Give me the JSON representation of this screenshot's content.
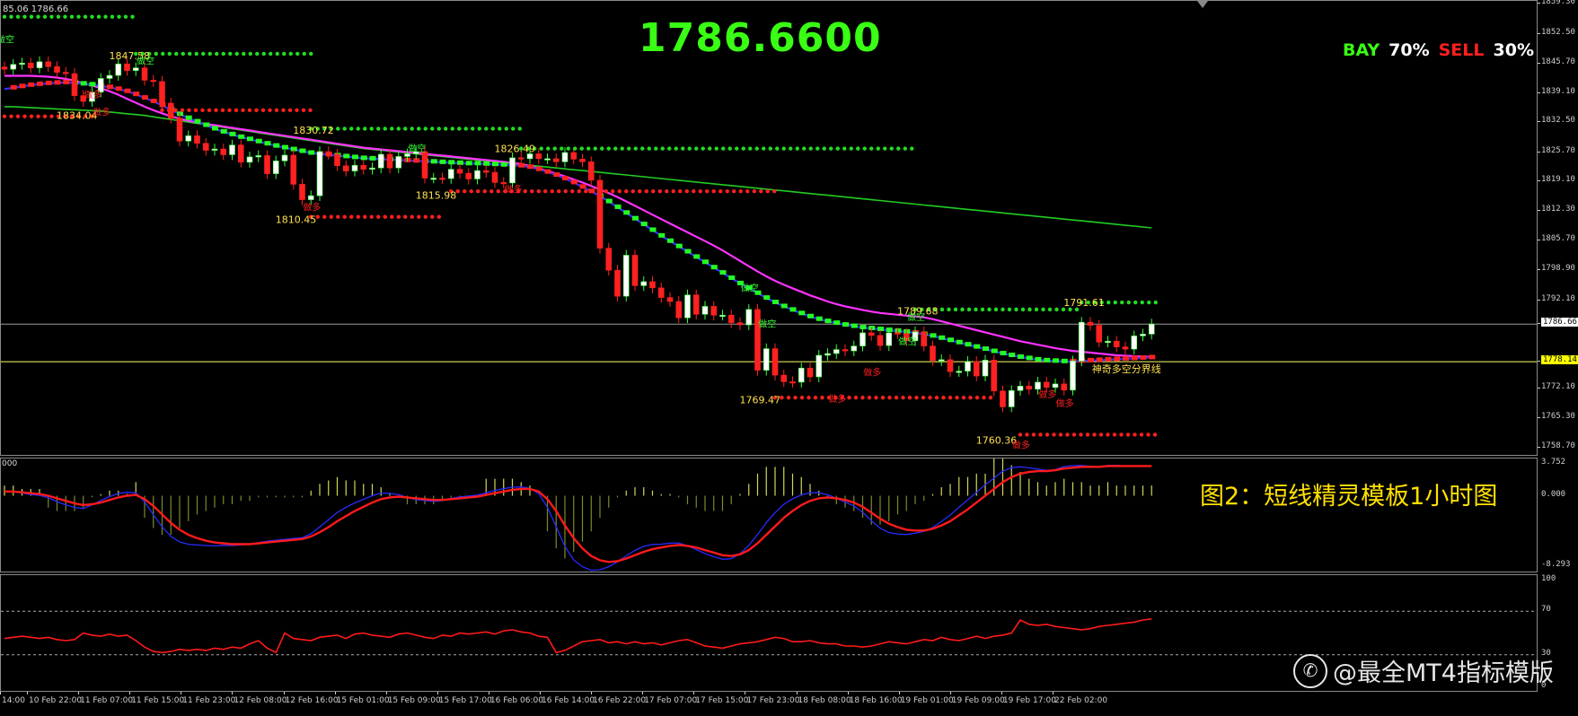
{
  "top_left_info": "85.06 1786.66",
  "big_price": "1786.6600",
  "signal": {
    "bay_label": "BAY",
    "bay_value": "70%",
    "sell_label": "SELL",
    "sell_value": "30%"
  },
  "caption": "图2：短线精灵模板1小时图",
  "watermark": "@最全MT4指标模版",
  "watermark_icon": "logo",
  "macd_top_left": "000",
  "colors": {
    "bull_candle": "#ffffff",
    "bear_candle": "#ff2020",
    "green_dots": "#22dd22",
    "red_dots": "#ff2020",
    "ma_magenta": "#ff33ff",
    "ma_blue": "#3030ff",
    "ma_green": "#22cc22",
    "price_line": "#ffff66",
    "label_yellow": "#ffe14d"
  },
  "price_axis": {
    "labels": [
      "1859.30",
      "1852.50",
      "1845.70",
      "1839.10",
      "1832.50",
      "1825.70",
      "1819.10",
      "1812.30",
      "1805.70",
      "1798.90",
      "1792.10",
      "1786.66",
      "1778.14",
      "1772.10",
      "1765.30",
      "1758.70"
    ],
    "values": [
      1859.3,
      1852.5,
      1845.7,
      1839.1,
      1832.5,
      1825.7,
      1819.1,
      1812.3,
      1805.7,
      1798.9,
      1792.1,
      1786.66,
      1778.14,
      1772.1,
      1765.3,
      1758.7
    ],
    "current_price": "1786.66",
    "yellow_line_price": "1778.14"
  },
  "macd_axis": {
    "labels": [
      "3.752",
      "0.000",
      "-8.293"
    ],
    "values": [
      3.752,
      0,
      -8.293
    ]
  },
  "rsi_axis": {
    "labels": [
      "100",
      "70",
      "30",
      "0"
    ],
    "values": [
      100,
      70,
      30,
      0
    ]
  },
  "time_axis": [
    "14:00",
    "10 Feb 22:00",
    "11 Feb 07:00",
    "11 Feb 15:00",
    "11 Feb 23:00",
    "12 Feb 08:00",
    "12 Feb 16:00",
    "15 Feb 01:00",
    "15 Feb 09:00",
    "15 Feb 17:00",
    "16 Feb 06:00",
    "16 Feb 14:00",
    "16 Feb 22:00",
    "17 Feb 07:00",
    "17 Feb 15:00",
    "17 Feb 23:00",
    "18 Feb 08:00",
    "18 Feb 16:00",
    "19 Feb 01:00",
    "19 Feb 09:00",
    "19 Feb 17:00",
    "22 Feb 02:00"
  ],
  "swing_labels": [
    {
      "text": "1847.58",
      "price": 1847.58,
      "bar": 14
    },
    {
      "text": "1834.04",
      "price": 1834.04,
      "bar": 8
    },
    {
      "text": "1830.72",
      "price": 1830.72,
      "bar": 35
    },
    {
      "text": "1810.45",
      "price": 1810.45,
      "bar": 33
    },
    {
      "text": "1815.98",
      "price": 1815.98,
      "bar": 49
    },
    {
      "text": "1826.49",
      "price": 1826.49,
      "bar": 58
    },
    {
      "text": "1789.68",
      "price": 1789.68,
      "bar": 104
    },
    {
      "text": "1769.47",
      "price": 1769.47,
      "bar": 86
    },
    {
      "text": "1760.36",
      "price": 1760.36,
      "bar": 113
    },
    {
      "text": "1791.61",
      "price": 1791.61,
      "bar": 123
    }
  ],
  "signal_tags": [
    {
      "text": "做空",
      "price": 1850.5,
      "bar": 0
    },
    {
      "text": "做空",
      "price": 1845.6,
      "bar": 16
    },
    {
      "text": "做多",
      "price": 1838.0,
      "bar": 10
    },
    {
      "text": "做多",
      "price": 1834.0,
      "bar": 11
    },
    {
      "text": "做空",
      "price": 1825.8,
      "bar": 47
    },
    {
      "text": "做多",
      "price": 1812.5,
      "bar": 35
    },
    {
      "text": "做多",
      "price": 1816.5,
      "bar": 58
    },
    {
      "text": "做空",
      "price": 1794.2,
      "bar": 85
    },
    {
      "text": "做空",
      "price": 1786.0,
      "bar": 87
    },
    {
      "text": "做多",
      "price": 1769.0,
      "bar": 95
    },
    {
      "text": "做空",
      "price": 1787.5,
      "bar": 104
    },
    {
      "text": "做空",
      "price": 1782.0,
      "bar": 103
    },
    {
      "text": "做多",
      "price": 1775.0,
      "bar": 99
    },
    {
      "text": "做多",
      "price": 1770.0,
      "bar": 119
    },
    {
      "text": "做多",
      "price": 1768.0,
      "bar": 121
    },
    {
      "text": "做多",
      "price": 1758.5,
      "bar": 116
    }
  ],
  "divider_label": "神奇多空分界线",
  "dot_lines": [
    {
      "color": "green",
      "price": 1856.4,
      "from": 0,
      "to": 15
    },
    {
      "color": "green",
      "price": 1848.0,
      "from": 15,
      "to": 35
    },
    {
      "color": "red",
      "price": 1833.8,
      "from": 0,
      "to": 10
    },
    {
      "color": "red",
      "price": 1835.2,
      "from": 18,
      "to": 35
    },
    {
      "color": "green",
      "price": 1831.0,
      "from": 35,
      "to": 59
    },
    {
      "color": "green",
      "price": 1826.5,
      "from": 59,
      "to": 104
    },
    {
      "color": "red",
      "price": 1811.0,
      "from": 35,
      "to": 50
    },
    {
      "color": "red",
      "price": 1816.8,
      "from": 51,
      "to": 88
    },
    {
      "color": "red",
      "price": 1770.0,
      "from": 88,
      "to": 113
    },
    {
      "color": "green",
      "price": 1790.0,
      "from": 104,
      "to": 123
    },
    {
      "color": "green",
      "price": 1791.6,
      "from": 123,
      "to": 132
    },
    {
      "color": "red",
      "price": 1761.6,
      "from": 116,
      "to": 132
    }
  ],
  "chart_data": {
    "type": "candlestick",
    "title": "",
    "bars": 132,
    "close": [
      1844.5,
      1845.6,
      1845.9,
      1844.8,
      1846.2,
      1845.1,
      1843.8,
      1843.5,
      1838.5,
      1837.2,
      1839.3,
      1842.4,
      1843.1,
      1845.7,
      1844.2,
      1844.8,
      1842.0,
      1841.7,
      1836.8,
      1833.4,
      1828.2,
      1829.4,
      1827.7,
      1826.1,
      1826.4,
      1825.1,
      1827.3,
      1823.4,
      1824.6,
      1824.9,
      1820.8,
      1823.7,
      1825.0,
      1818.4,
      1814.9,
      1815.8,
      1825.8,
      1825.2,
      1822.6,
      1821.4,
      1822.7,
      1821.8,
      1822.1,
      1825.2,
      1822.1,
      1824.7,
      1825.3,
      1825.8,
      1819.8,
      1819.8,
      1819.7,
      1821.8,
      1820.9,
      1819.6,
      1821.5,
      1821.1,
      1818.8,
      1818.7,
      1824.4,
      1824.2,
      1825.3,
      1824.2,
      1824.2,
      1823.5,
      1825.6,
      1824.1,
      1823.5,
      1819.3,
      1803.9,
      1798.9,
      1793.0,
      1802.3,
      1795.4,
      1796.3,
      1794.9,
      1792.7,
      1791.8,
      1788.1,
      1793.3,
      1788.9,
      1790.7,
      1788.7,
      1788.7,
      1787.0,
      1786.5,
      1790.0,
      1776.2,
      1781.1,
      1775.1,
      1773.6,
      1773.5,
      1776.7,
      1774.7,
      1779.6,
      1780.0,
      1780.9,
      1780.6,
      1781.7,
      1784.7,
      1784.1,
      1781.8,
      1784.7,
      1784.5,
      1782.9,
      1784.9,
      1781.7,
      1778.4,
      1778.6,
      1775.9,
      1776.0,
      1778.2,
      1774.9,
      1778.5,
      1771.5,
      1767.9,
      1771.6,
      1772.6,
      1771.9,
      1773.5,
      1772.3,
      1773.1,
      1771.7,
      1778.3,
      1787.1,
      1786.4,
      1782.6,
      1782.8,
      1781.5,
      1781.0,
      1784.0,
      1784.4,
      1786.7
    ],
    "ma_magenta": [
      1843,
      1843,
      1843,
      1843,
      1842.9,
      1842.8,
      1842.6,
      1842.3,
      1841.9,
      1841.3,
      1840.8,
      1840.2,
      1839.5,
      1838.7,
      1837.8,
      1836.9,
      1836,
      1835.2,
      1834.5,
      1833.8,
      1833.3,
      1832.8,
      1832.4,
      1832.1,
      1831.8,
      1831.5,
      1831.2,
      1830.9,
      1830.6,
      1830.3,
      1830,
      1829.7,
      1829.4,
      1829.1,
      1828.8,
      1828.5,
      1828.2,
      1827.9,
      1827.6,
      1827.3,
      1827,
      1826.7,
      1826.5,
      1826.3,
      1826.1,
      1825.9,
      1825.7,
      1825.5,
      1825.3,
      1825.1,
      1824.9,
      1824.7,
      1824.5,
      1824.3,
      1824.1,
      1823.9,
      1823.7,
      1823.5,
      1823.3,
      1823,
      1822.5,
      1822,
      1821.4,
      1820.8,
      1820.2,
      1819.5,
      1818.8,
      1818,
      1817.2,
      1816.4,
      1815.5,
      1814.5,
      1813.5,
      1812.5,
      1811.5,
      1810.5,
      1809.5,
      1808.5,
      1807.5,
      1806.5,
      1805.5,
      1804.5,
      1803.4,
      1802.2,
      1801,
      1799.8,
      1798.6,
      1797.5,
      1796.5,
      1795.6,
      1794.8,
      1794,
      1793.2,
      1792.5,
      1791.8,
      1791.2,
      1790.7,
      1790.3,
      1789.9,
      1789.5,
      1789.2,
      1789,
      1788.8,
      1788.6,
      1788.4,
      1788.2,
      1787.8,
      1787.3,
      1786.8,
      1786.3,
      1785.8,
      1785.3,
      1784.8,
      1784.3,
      1783.8,
      1783.3,
      1782.8,
      1782.4,
      1782,
      1781.6,
      1781.2,
      1780.9,
      1780.6,
      1780.4,
      1780.2,
      1780,
      1779.8,
      1779.6,
      1779.5,
      1779.4,
      1779.3,
      1779.2
    ],
    "ma_blue": [
      1840,
      1840.3,
      1840.6,
      1840.9,
      1841.1,
      1841.3,
      1841.4,
      1841.5,
      1841.4,
      1841.2,
      1841,
      1840.7,
      1840.4,
      1840,
      1839.5,
      1838.8,
      1838,
      1837.2,
      1836.3,
      1835.3,
      1834.3,
      1833.4,
      1832.6,
      1831.8,
      1831,
      1830.3,
      1829.7,
      1829.1,
      1828.6,
      1828.1,
      1827.6,
      1827.1,
      1826.7,
      1826.3,
      1825.9,
      1825.5,
      1825.3,
      1825.1,
      1824.9,
      1824.7,
      1824.5,
      1824.3,
      1824.2,
      1824.1,
      1824,
      1823.9,
      1823.8,
      1823.7,
      1823.6,
      1823.5,
      1823.4,
      1823.3,
      1823.2,
      1823.1,
      1823.1,
      1823,
      1822.9,
      1822.8,
      1822.7,
      1822.6,
      1822.3,
      1821.8,
      1821.2,
      1820.5,
      1819.7,
      1818.8,
      1817.8,
      1816.8,
      1815.7,
      1814.5,
      1813.2,
      1811.9,
      1810.6,
      1809.3,
      1808,
      1806.7,
      1805.5,
      1804.3,
      1803.1,
      1801.9,
      1800.7,
      1799.5,
      1798.3,
      1797.1,
      1795.9,
      1794.8,
      1793.7,
      1792.6,
      1791.6,
      1790.7,
      1789.9,
      1789.1,
      1788.4,
      1787.8,
      1787.3,
      1786.9,
      1786.5,
      1786.2,
      1785.9,
      1785.7,
      1785.5,
      1785.3,
      1785.1,
      1784.9,
      1784.7,
      1784.4,
      1784,
      1783.5,
      1783,
      1782.5,
      1782,
      1781.5,
      1781,
      1780.5,
      1780,
      1779.6,
      1779.2,
      1778.9,
      1778.6,
      1778.4,
      1778.3,
      1778.2,
      1778.2,
      1778.3,
      1778.4,
      1778.5,
      1778.6,
      1778.7,
      1778.8,
      1778.9,
      1779,
      1779.1
    ],
    "ma_green": [
      1836,
      1836,
      1835.9,
      1835.8,
      1835.7,
      1835.6,
      1835.5,
      1835.4,
      1835.3,
      1835.2,
      1835.1,
      1835,
      1834.8,
      1834.6,
      1834.4,
      1834.2,
      1834,
      1833.7,
      1833.4,
      1833.1,
      1832.8,
      1832.5,
      1832.2,
      1831.9,
      1831.6,
      1831.3,
      1831,
      1830.7,
      1830.4,
      1830.1,
      1829.8,
      1829.5,
      1829.2,
      1828.9,
      1828.6,
      1828.3,
      1828,
      1827.7,
      1827.4,
      1827.1,
      1826.8,
      1826.5,
      1826.3,
      1826.1,
      1825.9,
      1825.7,
      1825.5,
      1825.3,
      1825.1,
      1824.9,
      1824.7,
      1824.5,
      1824.3,
      1824.1,
      1823.9,
      1823.7,
      1823.5,
      1823.3,
      1823.1,
      1822.9,
      1822.7,
      1822.5,
      1822.3,
      1822.1,
      1821.9,
      1821.7,
      1821.5,
      1821.3,
      1821.1,
      1820.9,
      1820.7,
      1820.5,
      1820.3,
      1820.1,
      1819.9,
      1819.7,
      1819.5,
      1819.3,
      1819.1,
      1818.9,
      1818.7,
      1818.5,
      1818.3,
      1818.1,
      1817.9,
      1817.7,
      1817.5,
      1817.3,
      1817.1,
      1816.9,
      1816.7,
      1816.5,
      1816.3,
      1816.1,
      1815.9,
      1815.7,
      1815.5,
      1815.3,
      1815.1,
      1814.9,
      1814.7,
      1814.5,
      1814.3,
      1814.1,
      1813.9,
      1813.7,
      1813.5,
      1813.3,
      1813.1,
      1812.9,
      1812.7,
      1812.5,
      1812.3,
      1812.1,
      1811.9,
      1811.7,
      1811.5,
      1811.3,
      1811.1,
      1810.9,
      1810.7,
      1810.5,
      1810.3,
      1810.1,
      1809.9,
      1809.7,
      1809.5,
      1809.3,
      1809.1,
      1808.9,
      1808.7,
      1808.5
    ],
    "macd_signal": [
      0.5,
      0.5,
      0.4,
      0.3,
      0.2,
      0,
      -0.3,
      -0.6,
      -0.9,
      -1.1,
      -1,
      -0.8,
      -0.5,
      -0.2,
      0,
      0.1,
      -0.4,
      -1.2,
      -2.2,
      -3.2,
      -4,
      -4.6,
      -5,
      -5.3,
      -5.5,
      -5.6,
      -5.7,
      -5.7,
      -5.7,
      -5.6,
      -5.5,
      -5.4,
      -5.3,
      -5.2,
      -5.1,
      -4.8,
      -4.3,
      -3.7,
      -3,
      -2.4,
      -1.8,
      -1.3,
      -0.8,
      -0.4,
      -0.2,
      -0.1,
      -0.2,
      -0.3,
      -0.4,
      -0.5,
      -0.5,
      -0.4,
      -0.3,
      -0.2,
      -0.1,
      0.1,
      0.3,
      0.5,
      0.7,
      0.8,
      0.8,
      0.5,
      -0.4,
      -1.8,
      -3.5,
      -5,
      -6.2,
      -7.1,
      -7.6,
      -7.8,
      -7.7,
      -7.4,
      -7,
      -6.6,
      -6.3,
      -6.1,
      -5.9,
      -5.8,
      -5.9,
      -6.1,
      -6.4,
      -6.7,
      -7,
      -7.1,
      -6.9,
      -6.4,
      -5.6,
      -4.6,
      -3.6,
      -2.6,
      -1.8,
      -1.1,
      -0.6,
      -0.3,
      -0.2,
      -0.3,
      -0.5,
      -0.8,
      -1.3,
      -2,
      -2.7,
      -3.3,
      -3.7,
      -4,
      -4.1,
      -4.1,
      -3.9,
      -3.5,
      -3,
      -2.3,
      -1.6,
      -0.8,
      0,
      0.8,
      1.6,
      2.2,
      2.6,
      2.8,
      2.9,
      2.9,
      3,
      3.2,
      3.3,
      3.4,
      3.4,
      3.4,
      3.5,
      3.5,
      3.5,
      3.5,
      3.5,
      3.5
    ],
    "rsi": [
      45,
      46,
      47,
      46,
      45,
      46,
      44,
      43,
      44,
      50,
      48,
      47,
      49,
      47,
      48,
      43,
      37,
      33,
      32,
      33,
      35,
      34,
      35,
      34,
      36,
      35,
      37,
      36,
      40,
      43,
      36,
      32,
      50,
      45,
      44,
      43,
      46,
      47,
      48,
      45,
      49,
      50,
      48,
      47,
      46,
      49,
      50,
      48,
      46,
      45,
      48,
      47,
      50,
      49,
      50,
      51,
      49,
      52,
      53,
      51,
      50,
      47,
      46,
      32,
      34,
      38,
      42,
      43,
      44,
      41,
      42,
      40,
      42,
      40,
      41,
      39,
      41,
      43,
      44,
      41,
      38,
      37,
      36,
      38,
      40,
      41,
      42,
      44,
      46,
      45,
      42,
      42,
      43,
      41,
      40,
      40,
      38,
      38,
      37,
      38,
      40,
      42,
      41,
      40,
      42,
      44,
      43,
      46,
      44,
      43,
      45,
      47,
      45,
      47,
      48,
      50,
      62,
      58,
      57,
      58,
      56,
      55,
      54,
      53,
      54,
      56,
      57,
      58,
      59,
      60,
      62,
      63
    ]
  }
}
